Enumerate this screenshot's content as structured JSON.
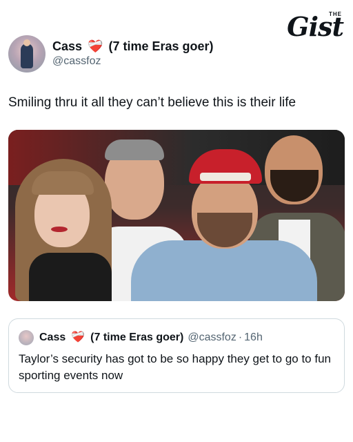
{
  "brand": {
    "super": "THE",
    "name": "Gist"
  },
  "author": {
    "name": "Cass",
    "emoji": "❤️‍🩹",
    "tagline": "(7 time Eras goer)",
    "handle": "@cassfoz"
  },
  "tweet": {
    "text": "Smiling thru it all they can’t believe this is their life"
  },
  "quote": {
    "name": "Cass",
    "emoji": "❤️‍🩹",
    "tagline": "(7 time Eras goer)",
    "handle": "@cassfoz",
    "separator": "·",
    "time": "16h",
    "text": "Taylor’s security has got to be so happy they get to go to fun sporting events now"
  },
  "colors": {
    "accent_heart": "#e0245e",
    "muted": "#536471",
    "border": "#cfd9de"
  }
}
